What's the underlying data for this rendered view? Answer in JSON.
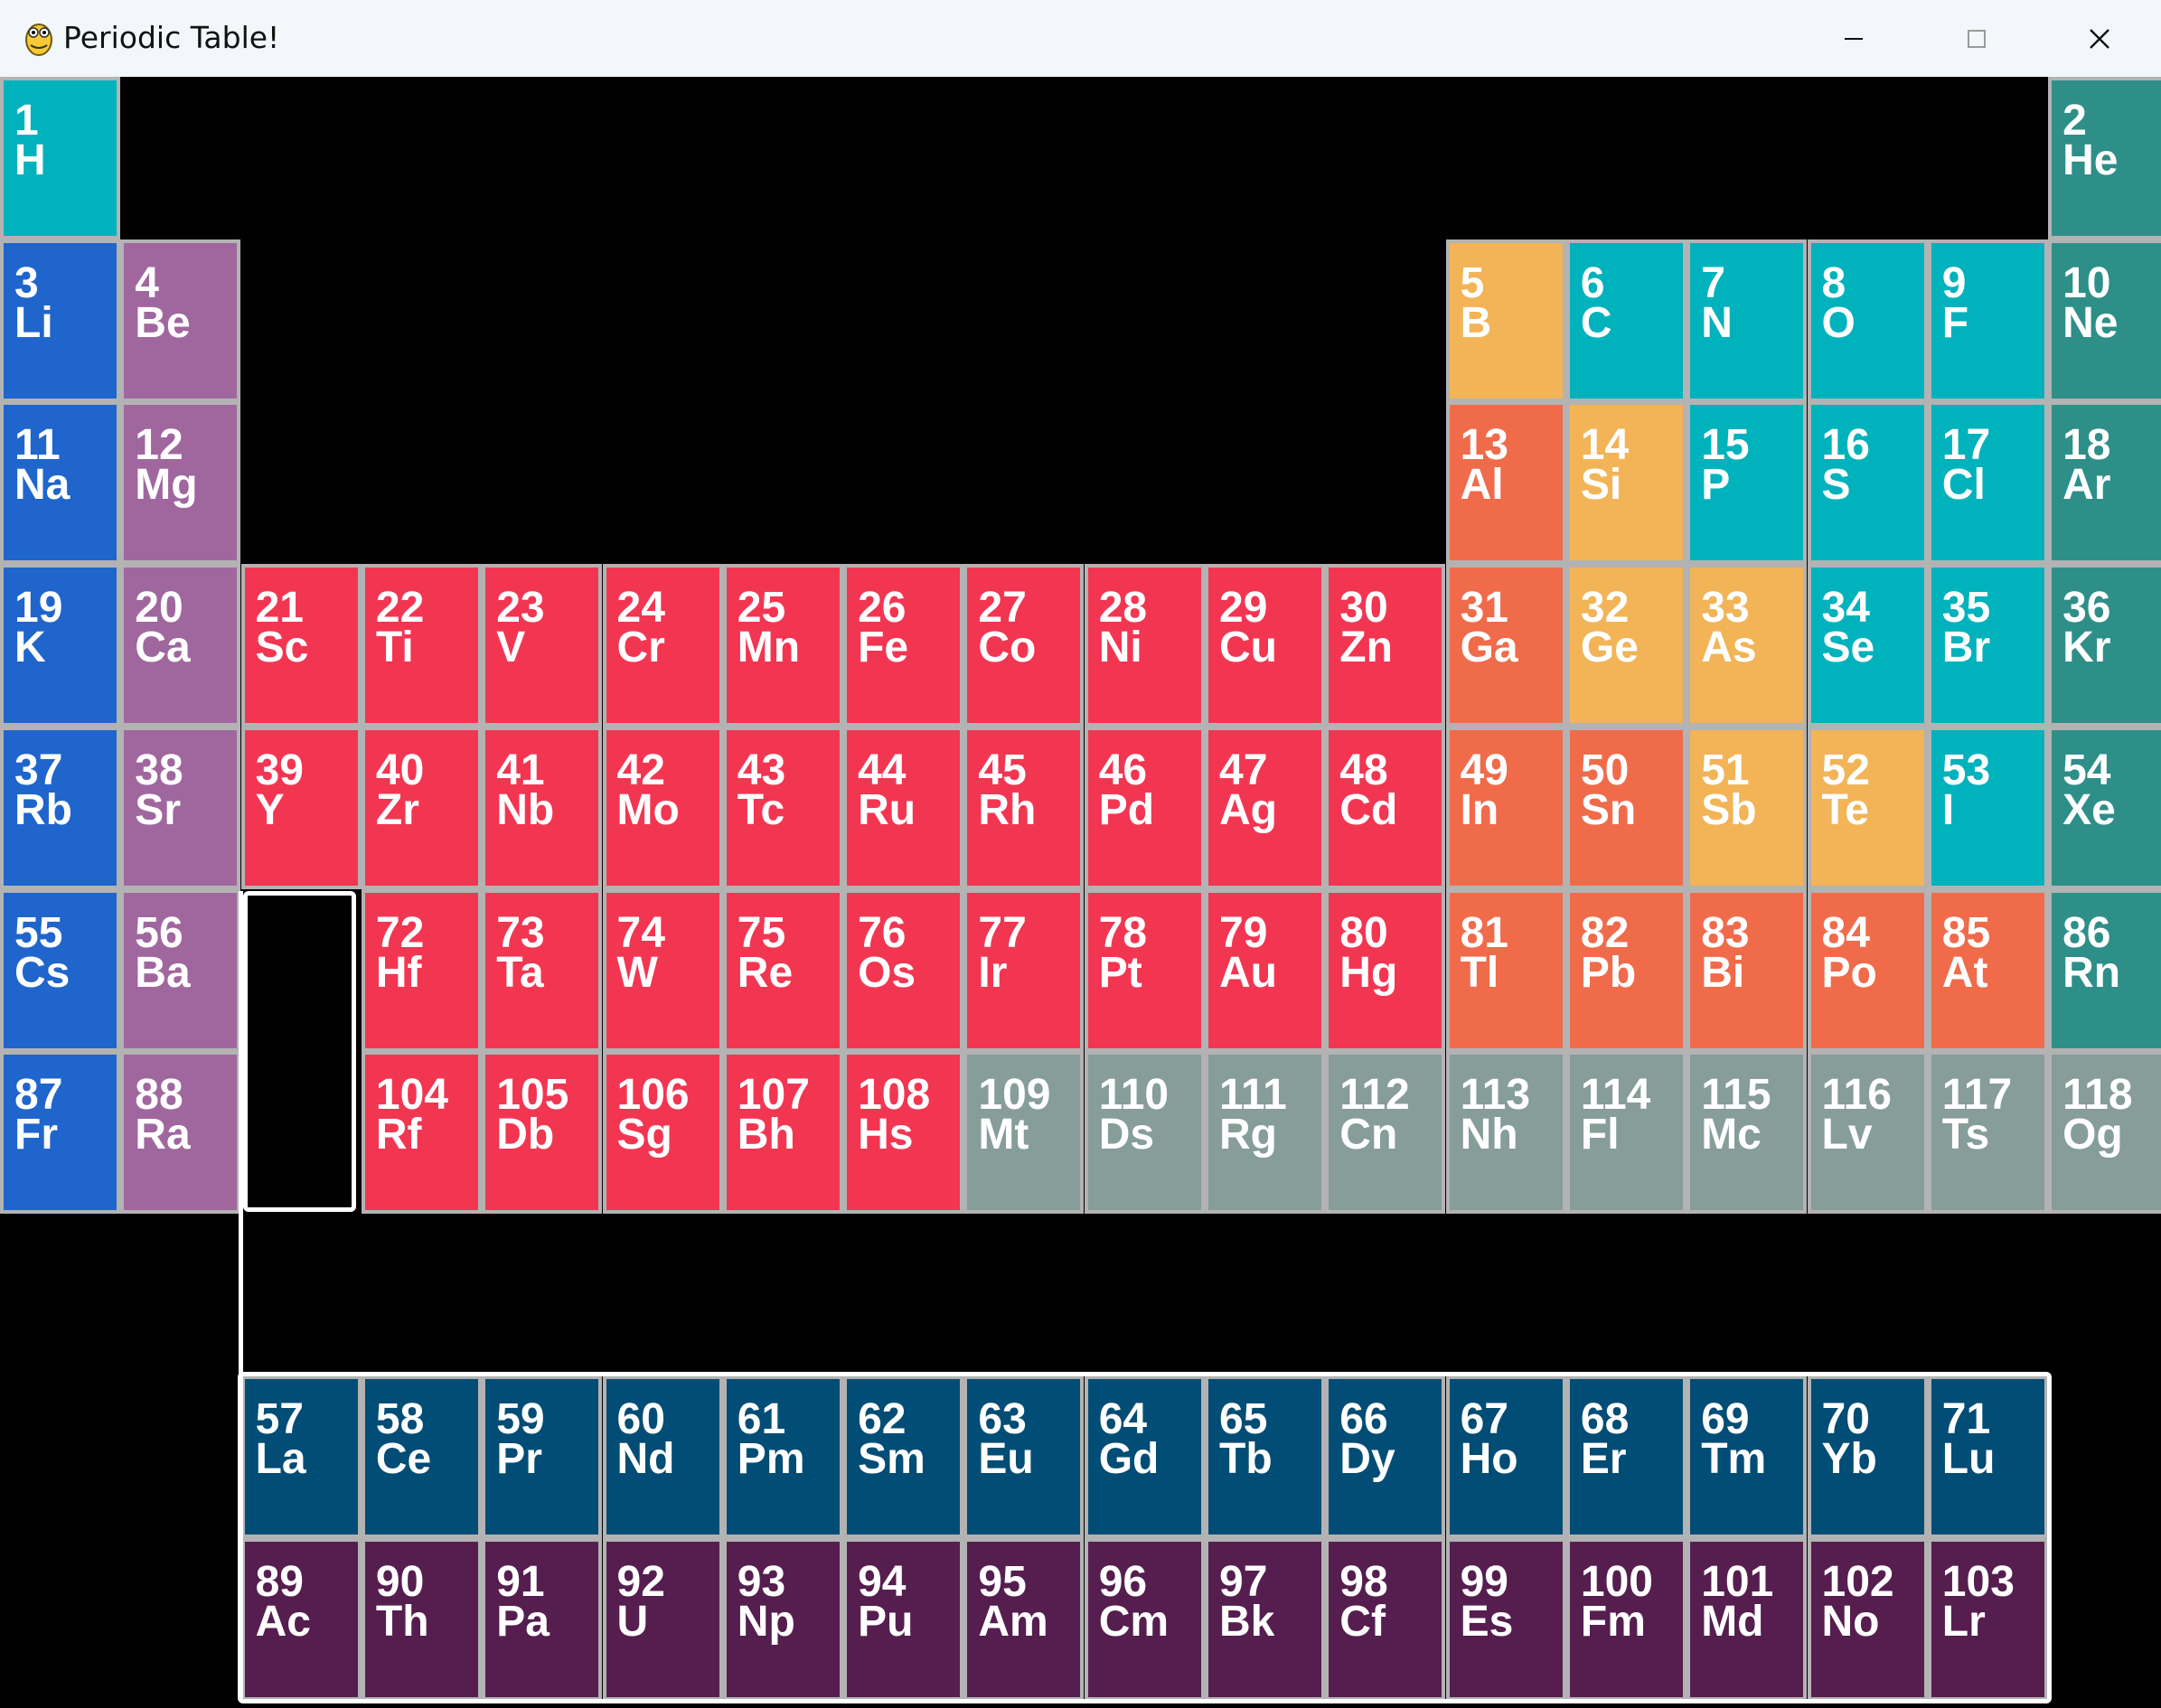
{
  "window": {
    "title": "Periodic Table!",
    "app_icon": "python-snake-icon",
    "controls": {
      "minimize_icon": "minimize-icon",
      "maximize_icon": "maximize-icon",
      "close_icon": "close-icon"
    }
  },
  "colors": {
    "alkali_metal": "#1f65cc",
    "alkaline_earth": "#a0679f",
    "transition_metal": "#f23652",
    "post_transition_metal": "#f06b4a",
    "metalloid": "#f2b457",
    "nonmetal": "#00b2bc",
    "noble_gas": "#2e8f88",
    "unknown": "#869d99",
    "lanthanide": "#024d75",
    "actinide": "#551e4f",
    "cell_border": "#b3b3b3",
    "selection": "#ffffff",
    "background": "#000000"
  },
  "elements": [
    {
      "n": "1",
      "s": "H",
      "c": "nonmetal",
      "row": 1,
      "col": 1
    },
    {
      "n": "2",
      "s": "He",
      "c": "noble_gas",
      "row": 1,
      "col": 18
    },
    {
      "n": "3",
      "s": "Li",
      "c": "alkali_metal",
      "row": 2,
      "col": 1
    },
    {
      "n": "4",
      "s": "Be",
      "c": "alkaline_earth",
      "row": 2,
      "col": 2
    },
    {
      "n": "5",
      "s": "B",
      "c": "metalloid",
      "row": 2,
      "col": 13
    },
    {
      "n": "6",
      "s": "C",
      "c": "nonmetal",
      "row": 2,
      "col": 14
    },
    {
      "n": "7",
      "s": "N",
      "c": "nonmetal",
      "row": 2,
      "col": 15
    },
    {
      "n": "8",
      "s": "O",
      "c": "nonmetal",
      "row": 2,
      "col": 16
    },
    {
      "n": "9",
      "s": "F",
      "c": "nonmetal",
      "row": 2,
      "col": 17
    },
    {
      "n": "10",
      "s": "Ne",
      "c": "noble_gas",
      "row": 2,
      "col": 18
    },
    {
      "n": "11",
      "s": "Na",
      "c": "alkali_metal",
      "row": 3,
      "col": 1
    },
    {
      "n": "12",
      "s": "Mg",
      "c": "alkaline_earth",
      "row": 3,
      "col": 2
    },
    {
      "n": "13",
      "s": "Al",
      "c": "post_transition_metal",
      "row": 3,
      "col": 13
    },
    {
      "n": "14",
      "s": "Si",
      "c": "metalloid",
      "row": 3,
      "col": 14
    },
    {
      "n": "15",
      "s": "P",
      "c": "nonmetal",
      "row": 3,
      "col": 15
    },
    {
      "n": "16",
      "s": "S",
      "c": "nonmetal",
      "row": 3,
      "col": 16
    },
    {
      "n": "17",
      "s": "Cl",
      "c": "nonmetal",
      "row": 3,
      "col": 17
    },
    {
      "n": "18",
      "s": "Ar",
      "c": "noble_gas",
      "row": 3,
      "col": 18
    },
    {
      "n": "19",
      "s": "K",
      "c": "alkali_metal",
      "row": 4,
      "col": 1
    },
    {
      "n": "20",
      "s": "Ca",
      "c": "alkaline_earth",
      "row": 4,
      "col": 2
    },
    {
      "n": "21",
      "s": "Sc",
      "c": "transition_metal",
      "row": 4,
      "col": 3
    },
    {
      "n": "22",
      "s": "Ti",
      "c": "transition_metal",
      "row": 4,
      "col": 4
    },
    {
      "n": "23",
      "s": "V",
      "c": "transition_metal",
      "row": 4,
      "col": 5
    },
    {
      "n": "24",
      "s": "Cr",
      "c": "transition_metal",
      "row": 4,
      "col": 6
    },
    {
      "n": "25",
      "s": "Mn",
      "c": "transition_metal",
      "row": 4,
      "col": 7
    },
    {
      "n": "26",
      "s": "Fe",
      "c": "transition_metal",
      "row": 4,
      "col": 8
    },
    {
      "n": "27",
      "s": "Co",
      "c": "transition_metal",
      "row": 4,
      "col": 9
    },
    {
      "n": "28",
      "s": "Ni",
      "c": "transition_metal",
      "row": 4,
      "col": 10
    },
    {
      "n": "29",
      "s": "Cu",
      "c": "transition_metal",
      "row": 4,
      "col": 11
    },
    {
      "n": "30",
      "s": "Zn",
      "c": "transition_metal",
      "row": 4,
      "col": 12
    },
    {
      "n": "31",
      "s": "Ga",
      "c": "post_transition_metal",
      "row": 4,
      "col": 13
    },
    {
      "n": "32",
      "s": "Ge",
      "c": "metalloid",
      "row": 4,
      "col": 14
    },
    {
      "n": "33",
      "s": "As",
      "c": "metalloid",
      "row": 4,
      "col": 15
    },
    {
      "n": "34",
      "s": "Se",
      "c": "nonmetal",
      "row": 4,
      "col": 16
    },
    {
      "n": "35",
      "s": "Br",
      "c": "nonmetal",
      "row": 4,
      "col": 17
    },
    {
      "n": "36",
      "s": "Kr",
      "c": "noble_gas",
      "row": 4,
      "col": 18
    },
    {
      "n": "37",
      "s": "Rb",
      "c": "alkali_metal",
      "row": 5,
      "col": 1
    },
    {
      "n": "38",
      "s": "Sr",
      "c": "alkaline_earth",
      "row": 5,
      "col": 2
    },
    {
      "n": "39",
      "s": "Y",
      "c": "transition_metal",
      "row": 5,
      "col": 3
    },
    {
      "n": "40",
      "s": "Zr",
      "c": "transition_metal",
      "row": 5,
      "col": 4
    },
    {
      "n": "41",
      "s": "Nb",
      "c": "transition_metal",
      "row": 5,
      "col": 5
    },
    {
      "n": "42",
      "s": "Mo",
      "c": "transition_metal",
      "row": 5,
      "col": 6
    },
    {
      "n": "43",
      "s": "Tc",
      "c": "transition_metal",
      "row": 5,
      "col": 7
    },
    {
      "n": "44",
      "s": "Ru",
      "c": "transition_metal",
      "row": 5,
      "col": 8
    },
    {
      "n": "45",
      "s": "Rh",
      "c": "transition_metal",
      "row": 5,
      "col": 9
    },
    {
      "n": "46",
      "s": "Pd",
      "c": "transition_metal",
      "row": 5,
      "col": 10
    },
    {
      "n": "47",
      "s": "Ag",
      "c": "transition_metal",
      "row": 5,
      "col": 11
    },
    {
      "n": "48",
      "s": "Cd",
      "c": "transition_metal",
      "row": 5,
      "col": 12
    },
    {
      "n": "49",
      "s": "In",
      "c": "post_transition_metal",
      "row": 5,
      "col": 13
    },
    {
      "n": "50",
      "s": "Sn",
      "c": "post_transition_metal",
      "row": 5,
      "col": 14
    },
    {
      "n": "51",
      "s": "Sb",
      "c": "metalloid",
      "row": 5,
      "col": 15
    },
    {
      "n": "52",
      "s": "Te",
      "c": "metalloid",
      "row": 5,
      "col": 16
    },
    {
      "n": "53",
      "s": "I",
      "c": "nonmetal",
      "row": 5,
      "col": 17
    },
    {
      "n": "54",
      "s": "Xe",
      "c": "noble_gas",
      "row": 5,
      "col": 18
    },
    {
      "n": "55",
      "s": "Cs",
      "c": "alkali_metal",
      "row": 6,
      "col": 1
    },
    {
      "n": "56",
      "s": "Ba",
      "c": "alkaline_earth",
      "row": 6,
      "col": 2
    },
    {
      "n": "72",
      "s": "Hf",
      "c": "transition_metal",
      "row": 6,
      "col": 4
    },
    {
      "n": "73",
      "s": "Ta",
      "c": "transition_metal",
      "row": 6,
      "col": 5
    },
    {
      "n": "74",
      "s": "W",
      "c": "transition_metal",
      "row": 6,
      "col": 6
    },
    {
      "n": "75",
      "s": "Re",
      "c": "transition_metal",
      "row": 6,
      "col": 7
    },
    {
      "n": "76",
      "s": "Os",
      "c": "transition_metal",
      "row": 6,
      "col": 8
    },
    {
      "n": "77",
      "s": "Ir",
      "c": "transition_metal",
      "row": 6,
      "col": 9
    },
    {
      "n": "78",
      "s": "Pt",
      "c": "transition_metal",
      "row": 6,
      "col": 10
    },
    {
      "n": "79",
      "s": "Au",
      "c": "transition_metal",
      "row": 6,
      "col": 11
    },
    {
      "n": "80",
      "s": "Hg",
      "c": "transition_metal",
      "row": 6,
      "col": 12
    },
    {
      "n": "81",
      "s": "Tl",
      "c": "post_transition_metal",
      "row": 6,
      "col": 13
    },
    {
      "n": "82",
      "s": "Pb",
      "c": "post_transition_metal",
      "row": 6,
      "col": 14
    },
    {
      "n": "83",
      "s": "Bi",
      "c": "post_transition_metal",
      "row": 6,
      "col": 15
    },
    {
      "n": "84",
      "s": "Po",
      "c": "post_transition_metal",
      "row": 6,
      "col": 16
    },
    {
      "n": "85",
      "s": "At",
      "c": "post_transition_metal",
      "row": 6,
      "col": 17
    },
    {
      "n": "86",
      "s": "Rn",
      "c": "noble_gas",
      "row": 6,
      "col": 18
    },
    {
      "n": "87",
      "s": "Fr",
      "c": "alkali_metal",
      "row": 7,
      "col": 1
    },
    {
      "n": "88",
      "s": "Ra",
      "c": "alkaline_earth",
      "row": 7,
      "col": 2
    },
    {
      "n": "104",
      "s": "Rf",
      "c": "transition_metal",
      "row": 7,
      "col": 4
    },
    {
      "n": "105",
      "s": "Db",
      "c": "transition_metal",
      "row": 7,
      "col": 5
    },
    {
      "n": "106",
      "s": "Sg",
      "c": "transition_metal",
      "row": 7,
      "col": 6
    },
    {
      "n": "107",
      "s": "Bh",
      "c": "transition_metal",
      "row": 7,
      "col": 7
    },
    {
      "n": "108",
      "s": "Hs",
      "c": "transition_metal",
      "row": 7,
      "col": 8
    },
    {
      "n": "109",
      "s": "Mt",
      "c": "unknown",
      "row": 7,
      "col": 9
    },
    {
      "n": "110",
      "s": "Ds",
      "c": "unknown",
      "row": 7,
      "col": 10
    },
    {
      "n": "111",
      "s": "Rg",
      "c": "unknown",
      "row": 7,
      "col": 11
    },
    {
      "n": "112",
      "s": "Cn",
      "c": "unknown",
      "row": 7,
      "col": 12
    },
    {
      "n": "113",
      "s": "Nh",
      "c": "unknown",
      "row": 7,
      "col": 13
    },
    {
      "n": "114",
      "s": "Fl",
      "c": "unknown",
      "row": 7,
      "col": 14
    },
    {
      "n": "115",
      "s": "Mc",
      "c": "unknown",
      "row": 7,
      "col": 15
    },
    {
      "n": "116",
      "s": "Lv",
      "c": "unknown",
      "row": 7,
      "col": 16
    },
    {
      "n": "117",
      "s": "Ts",
      "c": "unknown",
      "row": 7,
      "col": 17
    },
    {
      "n": "118",
      "s": "Og",
      "c": "unknown",
      "row": 7,
      "col": 18
    },
    {
      "n": "57",
      "s": "La",
      "c": "lanthanide",
      "row": 9,
      "col": 3
    },
    {
      "n": "58",
      "s": "Ce",
      "c": "lanthanide",
      "row": 9,
      "col": 4
    },
    {
      "n": "59",
      "s": "Pr",
      "c": "lanthanide",
      "row": 9,
      "col": 5
    },
    {
      "n": "60",
      "s": "Nd",
      "c": "lanthanide",
      "row": 9,
      "col": 6
    },
    {
      "n": "61",
      "s": "Pm",
      "c": "lanthanide",
      "row": 9,
      "col": 7
    },
    {
      "n": "62",
      "s": "Sm",
      "c": "lanthanide",
      "row": 9,
      "col": 8
    },
    {
      "n": "63",
      "s": "Eu",
      "c": "lanthanide",
      "row": 9,
      "col": 9
    },
    {
      "n": "64",
      "s": "Gd",
      "c": "lanthanide",
      "row": 9,
      "col": 10
    },
    {
      "n": "65",
      "s": "Tb",
      "c": "lanthanide",
      "row": 9,
      "col": 11
    },
    {
      "n": "66",
      "s": "Dy",
      "c": "lanthanide",
      "row": 9,
      "col": 12
    },
    {
      "n": "67",
      "s": "Ho",
      "c": "lanthanide",
      "row": 9,
      "col": 13
    },
    {
      "n": "68",
      "s": "Er",
      "c": "lanthanide",
      "row": 9,
      "col": 14
    },
    {
      "n": "69",
      "s": "Tm",
      "c": "lanthanide",
      "row": 9,
      "col": 15
    },
    {
      "n": "70",
      "s": "Yb",
      "c": "lanthanide",
      "row": 9,
      "col": 16
    },
    {
      "n": "71",
      "s": "Lu",
      "c": "lanthanide",
      "row": 9,
      "col": 17
    },
    {
      "n": "89",
      "s": "Ac",
      "c": "actinide",
      "row": 10,
      "col": 3
    },
    {
      "n": "90",
      "s": "Th",
      "c": "actinide",
      "row": 10,
      "col": 4
    },
    {
      "n": "91",
      "s": "Pa",
      "c": "actinide",
      "row": 10,
      "col": 5
    },
    {
      "n": "92",
      "s": "U",
      "c": "actinide",
      "row": 10,
      "col": 6
    },
    {
      "n": "93",
      "s": "Np",
      "c": "actinide",
      "row": 10,
      "col": 7
    },
    {
      "n": "94",
      "s": "Pu",
      "c": "actinide",
      "row": 10,
      "col": 8
    },
    {
      "n": "95",
      "s": "Am",
      "c": "actinide",
      "row": 10,
      "col": 9
    },
    {
      "n": "96",
      "s": "Cm",
      "c": "actinide",
      "row": 10,
      "col": 10
    },
    {
      "n": "97",
      "s": "Bk",
      "c": "actinide",
      "row": 10,
      "col": 11
    },
    {
      "n": "98",
      "s": "Cf",
      "c": "actinide",
      "row": 10,
      "col": 12
    },
    {
      "n": "99",
      "s": "Es",
      "c": "actinide",
      "row": 10,
      "col": 13
    },
    {
      "n": "100",
      "s": "Fm",
      "c": "actinide",
      "row": 10,
      "col": 14
    },
    {
      "n": "101",
      "s": "Md",
      "c": "actinide",
      "row": 10,
      "col": 15
    },
    {
      "n": "102",
      "s": "No",
      "c": "actinide",
      "row": 10,
      "col": 16
    },
    {
      "n": "103",
      "s": "Lr",
      "c": "actinide",
      "row": 10,
      "col": 17
    }
  ],
  "selection": {
    "placeholder_row": 6,
    "placeholder_col": 3,
    "highlighted_block": "lanthanides-actinides"
  }
}
